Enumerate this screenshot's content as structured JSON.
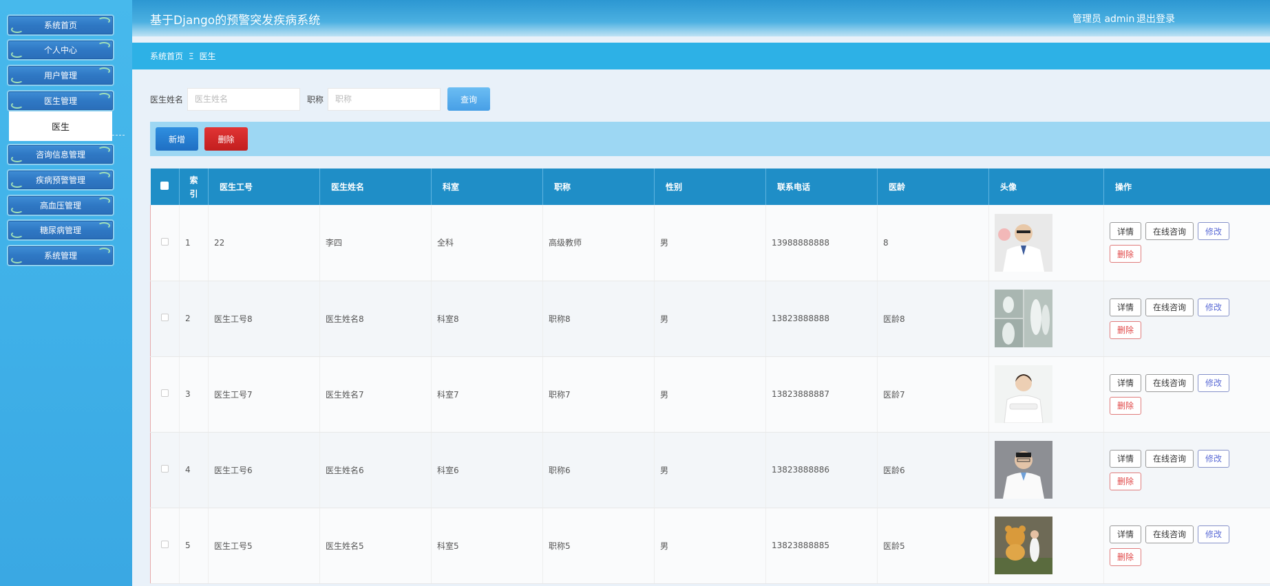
{
  "sidebar": {
    "menu": [
      {
        "label": "系统首页"
      },
      {
        "label": "个人中心"
      },
      {
        "label": "用户管理"
      },
      {
        "label": "医生管理"
      },
      {
        "label": "咨询信息管理"
      },
      {
        "label": "疾病预警管理"
      },
      {
        "label": "高血压管理"
      },
      {
        "label": "糖尿病管理"
      },
      {
        "label": "系统管理"
      }
    ],
    "submenu": {
      "label": "医生"
    }
  },
  "header": {
    "title": "基于Django的预警突发疾病系统",
    "user": "管理员 admin",
    "logout": "退出登录"
  },
  "breadcrumb": {
    "home": "系统首页",
    "separator": "Ξ",
    "current": "医生"
  },
  "search": {
    "name_label": "医生姓名",
    "name_placeholder": "医生姓名",
    "title_label": "职称",
    "title_placeholder": "职称",
    "query_label": "查询"
  },
  "actions": {
    "add": "新增",
    "delete": "删除"
  },
  "table": {
    "headers": {
      "index": "索\n引",
      "doctor_id": "医生工号",
      "doctor_name": "医生姓名",
      "department": "科室",
      "title": "职称",
      "gender": "性别",
      "phone": "联系电话",
      "age": "医龄",
      "avatar": "头像",
      "ops": "操作"
    },
    "op_labels": {
      "detail": "详情",
      "consult": "在线咨询",
      "edit": "修改",
      "delete": "删除"
    },
    "rows": [
      {
        "index": "1",
        "doctor_id": "22",
        "doctor_name": "李四",
        "department": "全科",
        "title": "高级教师",
        "gender": "男",
        "phone": "13988888888",
        "age": "8"
      },
      {
        "index": "2",
        "doctor_id": "医生工号8",
        "doctor_name": "医生姓名8",
        "department": "科室8",
        "title": "职称8",
        "gender": "男",
        "phone": "13823888888",
        "age": "医龄8"
      },
      {
        "index": "3",
        "doctor_id": "医生工号7",
        "doctor_name": "医生姓名7",
        "department": "科室7",
        "title": "职称7",
        "gender": "男",
        "phone": "13823888887",
        "age": "医龄7"
      },
      {
        "index": "4",
        "doctor_id": "医生工号6",
        "doctor_name": "医生姓名6",
        "department": "科室6",
        "title": "职称6",
        "gender": "男",
        "phone": "13823888886",
        "age": "医龄6"
      },
      {
        "index": "5",
        "doctor_id": "医生工号5",
        "doctor_name": "医生姓名5",
        "department": "科室5",
        "title": "职称5",
        "gender": "男",
        "phone": "13823888885",
        "age": "医龄5"
      }
    ]
  }
}
